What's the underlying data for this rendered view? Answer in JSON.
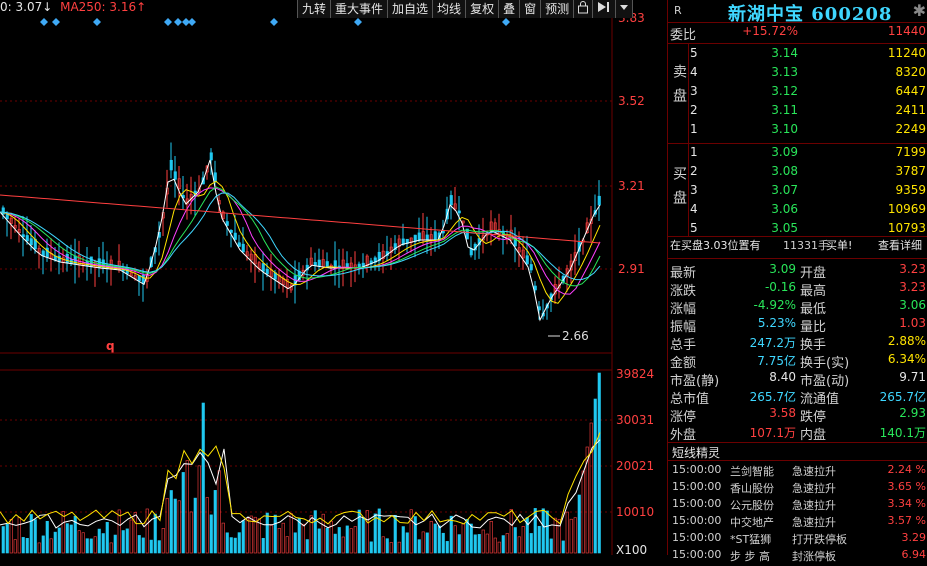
{
  "ma_legend": [
    {
      "text": "0: 3.07↓",
      "color": "#e6e6e6"
    },
    {
      "text": "MA250: 3.16↑",
      "color": "#ff4040"
    }
  ],
  "toolbar": [
    "九转",
    "重大事件",
    "加自选",
    "均线",
    "复权",
    "叠",
    "窗",
    "预测"
  ],
  "toolbar_icons": [
    "lock-icon",
    "play-step-icon",
    "dropdown-icon"
  ],
  "price_axis": [
    "3.83",
    "3.52",
    "3.21",
    "2.91"
  ],
  "volume_axis": [
    "39824",
    "30031",
    "20021",
    "10010",
    "X100"
  ],
  "low_marker": "2.66",
  "q_marker": "q",
  "header": {
    "r": "R",
    "stock_name": "新湖中宝",
    "stock_code": "600208"
  },
  "weibi": {
    "label": "委比",
    "pct": "+15.72%",
    "value": "11440"
  },
  "sell_label": "卖盘",
  "buy_label": "买盘",
  "sell": [
    {
      "lvl": "5",
      "price": "3.14",
      "vol": "11240"
    },
    {
      "lvl": "4",
      "price": "3.13",
      "vol": "8320"
    },
    {
      "lvl": "3",
      "price": "3.12",
      "vol": "6447"
    },
    {
      "lvl": "2",
      "price": "3.11",
      "vol": "2411"
    },
    {
      "lvl": "1",
      "price": "3.10",
      "vol": "2249"
    }
  ],
  "buy": [
    {
      "lvl": "1",
      "price": "3.09",
      "vol": "7199"
    },
    {
      "lvl": "2",
      "price": "3.08",
      "vol": "3787"
    },
    {
      "lvl": "3",
      "price": "3.07",
      "vol": "9359"
    },
    {
      "lvl": "4",
      "price": "3.06",
      "vol": "10969"
    },
    {
      "lvl": "5",
      "price": "3.05",
      "vol": "10793"
    }
  ],
  "notice": {
    "prefix": "在买盘3.03位置有",
    "amount": "11331手",
    "suffix": "买单!",
    "link": "查看详细"
  },
  "stats": [
    {
      "l": "最新",
      "lv": "3.09",
      "lc": "green",
      "r": "开盘",
      "rv": "3.23",
      "rc": "red"
    },
    {
      "l": "涨跌",
      "lv": "-0.16",
      "lc": "green",
      "r": "最高",
      "rv": "3.23",
      "rc": "red"
    },
    {
      "l": "涨幅",
      "lv": "-4.92%",
      "lc": "green",
      "r": "最低",
      "rv": "3.06",
      "rc": "green"
    },
    {
      "l": "振幅",
      "lv": "5.23%",
      "lc": "cyan",
      "r": "量比",
      "rv": "1.03",
      "rc": "red"
    },
    {
      "l": "总手",
      "lv": "247.2万",
      "lc": "cyan",
      "r": "换手",
      "rv": "2.88%",
      "rc": "yellow"
    },
    {
      "l": "金额",
      "lv": "7.75亿",
      "lc": "cyan",
      "r": "换手(实)",
      "rv": "6.34%",
      "rc": "yellow"
    },
    {
      "l": "市盈(静)",
      "lv": "8.40",
      "lc": "white",
      "r": "市盈(动)",
      "rv": "9.71",
      "rc": "white"
    },
    {
      "l": "总市值",
      "lv": "265.7亿",
      "lc": "cyan",
      "r": "流通值",
      "rv": "265.7亿",
      "rc": "cyan"
    },
    {
      "l": "涨停",
      "lv": "3.58",
      "lc": "red",
      "r": "跌停",
      "rv": "2.93",
      "rc": "green"
    },
    {
      "l": "外盘",
      "lv": "107.1万",
      "lc": "red",
      "r": "内盘",
      "rv": "140.1万",
      "rc": "green"
    }
  ],
  "spirit": {
    "title": "短线精灵",
    "items": [
      {
        "time": "15:00:00",
        "name": "兰剑智能",
        "event": "急速拉升",
        "pct": "2.24 %"
      },
      {
        "time": "15:00:00",
        "name": "香山股份",
        "event": "急速拉升",
        "pct": "3.65 %"
      },
      {
        "time": "15:00:00",
        "name": "公元股份",
        "event": "急速拉升",
        "pct": "3.34 %"
      },
      {
        "time": "15:00:00",
        "name": "中交地产",
        "event": "急速拉升",
        "pct": "3.57 %"
      },
      {
        "time": "15:00:00",
        "name": "*ST猛狮",
        "event": "打开跌停板",
        "pct": "3.29"
      },
      {
        "time": "15:00:00",
        "name": "步 步 高",
        "event": "封涨停板",
        "pct": "6.94"
      }
    ]
  },
  "colors": {
    "up": "#ff4040",
    "down": "#29e65a",
    "grid": "#6b0000",
    "flag": "#3fa9f5"
  }
}
